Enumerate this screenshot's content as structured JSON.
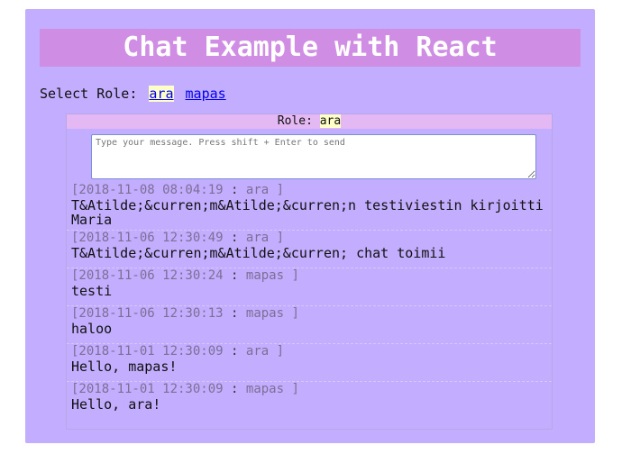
{
  "header": {
    "title": "Chat Example with React"
  },
  "role_select": {
    "label": "Select Role:",
    "options": [
      {
        "label": "ara",
        "active": true
      },
      {
        "label": "mapas",
        "active": false
      }
    ]
  },
  "chat": {
    "role_label": "Role:",
    "role_value": "ara",
    "input": {
      "placeholder": "Type your message. Press shift + Enter to send",
      "value": ""
    },
    "messages": [
      {
        "timestamp": "[2018-11-08 08:04:19",
        "separator": ":",
        "author": "ara ]",
        "text": "T&Atilde;&curren;m&Atilde;&curren;n testiviestin kirjoitti Maria"
      },
      {
        "timestamp": "[2018-11-06 12:30:49",
        "separator": ":",
        "author": "ara ]",
        "text": "T&Atilde;&curren;m&Atilde;&curren; chat toimii"
      },
      {
        "timestamp": "[2018-11-06 12:30:24",
        "separator": ":",
        "author": "mapas ]",
        "text": "testi"
      },
      {
        "timestamp": "[2018-11-06 12:30:13",
        "separator": ":",
        "author": "mapas ]",
        "text": "haloo"
      },
      {
        "timestamp": "[2018-11-01 12:30:09",
        "separator": ":",
        "author": "ara ]",
        "text": "Hello, mapas!"
      },
      {
        "timestamp": "[2018-11-01 12:30:09",
        "separator": ":",
        "author": "mapas ]",
        "text": "Hello, ara!"
      }
    ]
  },
  "colors": {
    "background": "#c3adff",
    "banner": "#cf8de3",
    "chat_header": "#e3b8f3",
    "highlight": "#ffffc8",
    "meta_text": "#7b6f96"
  }
}
